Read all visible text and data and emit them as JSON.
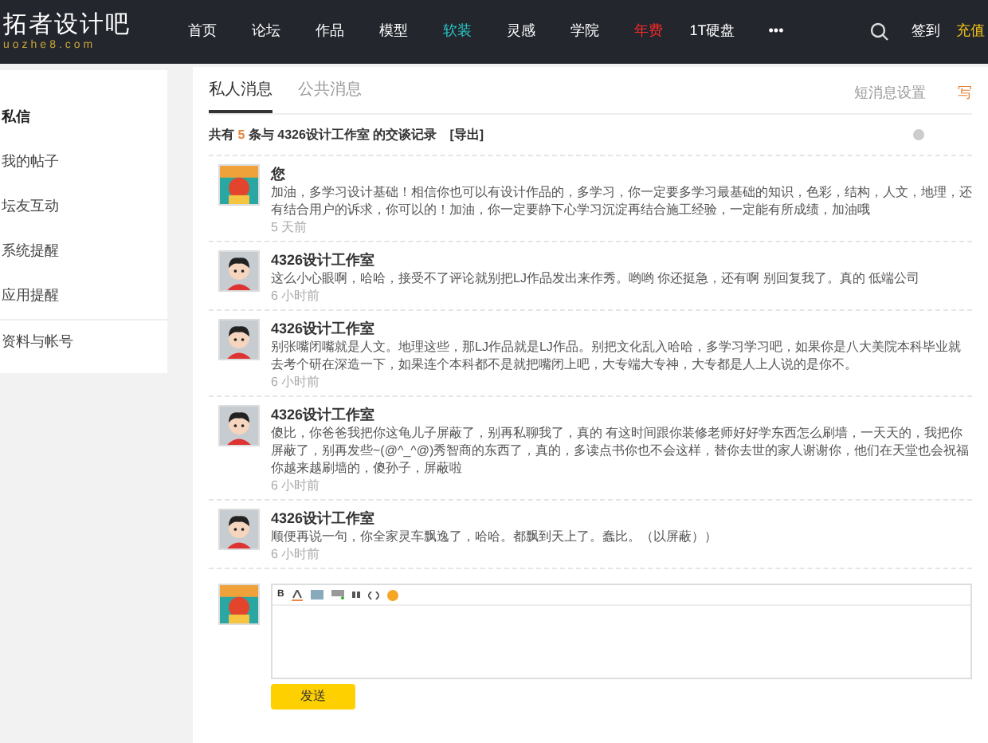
{
  "logo": {
    "name": "拓者设计吧",
    "domain": "uozhe8.com"
  },
  "nav": [
    {
      "label": "首页",
      "kind": "normal"
    },
    {
      "label": "论坛",
      "kind": "normal"
    },
    {
      "label": "作品",
      "kind": "normal"
    },
    {
      "label": "模型",
      "kind": "normal"
    },
    {
      "label": "软装",
      "kind": "accent"
    },
    {
      "label": "灵感",
      "kind": "normal"
    },
    {
      "label": "学院",
      "kind": "normal"
    },
    {
      "label": "年费",
      "kind": "hot"
    },
    {
      "label": "1T硬盘",
      "kind": "normal"
    },
    {
      "label": "•••",
      "kind": "normal"
    }
  ],
  "header_actions": {
    "sign_in": "签到",
    "recharge": "充值"
  },
  "sidebar": {
    "items": [
      {
        "label": "私信",
        "selected": true
      },
      {
        "label": "我的帖子",
        "selected": false
      },
      {
        "label": "坛友互动",
        "selected": false
      },
      {
        "label": "系统提醒",
        "selected": false
      },
      {
        "label": "应用提醒",
        "selected": false
      },
      {
        "label": "资料与帐号",
        "selected": false
      }
    ]
  },
  "tabs": [
    {
      "label": "私人消息",
      "selected": true
    },
    {
      "label": "公共消息",
      "selected": false
    }
  ],
  "tab_links": [
    "短消息设置",
    "写"
  ],
  "summary": {
    "prefix": "共有",
    "count": "5",
    "middle": "条与",
    "partner": "4326设计工作室",
    "suffix": "的交谈记录",
    "export": "[导出]"
  },
  "messages": [
    {
      "sender": "您",
      "kind": "poster",
      "text": "加油，多学习设计基础！相信你也可以有设计作品的，多学习，你一定要多学习最基础的知识，色彩，结构，人文，地理，还有结合用户的诉求，你可以的！加油，你一定要静下心学习沉淀再结合施工经验，一定能有所成绩，加油哦",
      "time": "5 天前"
    },
    {
      "sender": "4326设计工作室",
      "kind": "cartoon",
      "text": "这么小心眼啊，哈哈，接受不了评论就别把LJ作品发出来作秀。哟哟 你还挺急，还有啊 别回复我了。真的 低端公司",
      "time": "6 小时前"
    },
    {
      "sender": "4326设计工作室",
      "kind": "cartoon",
      "text": "别张嘴闭嘴就是人文。地理这些，那LJ作品就是LJ作品。别把文化乱入哈哈，多学习学习吧，如果你是八大美院本科毕业就去考个研在深造一下，如果连个本科都不是就把嘴闭上吧，大专端大专神，大专都是人上人说的是你不。",
      "time": "6 小时前"
    },
    {
      "sender": "4326设计工作室",
      "kind": "cartoon",
      "text": "傻比，你爸爸我把你这龟儿子屏蔽了，别再私聊我了，真的 有这时间跟你装修老师好好学东西怎么刷墙，一天天的，我把你屏蔽了，别再发些~(@^_^@)秀智商的东西了，真的，多读点书你也不会这样，替你去世的家人谢谢你，他们在天堂也会祝福你越来越刷墙的，傻孙子，屏蔽啦",
      "time": "6 小时前"
    },
    {
      "sender": "4326设计工作室",
      "kind": "cartoon",
      "text": "顺便再说一句，你全家灵车飘逸了，哈哈。都飘到天上了。蠢比。（以屏蔽））",
      "time": "6 小时前"
    }
  ],
  "composer": {
    "bold_label": "B",
    "send": "发送"
  }
}
